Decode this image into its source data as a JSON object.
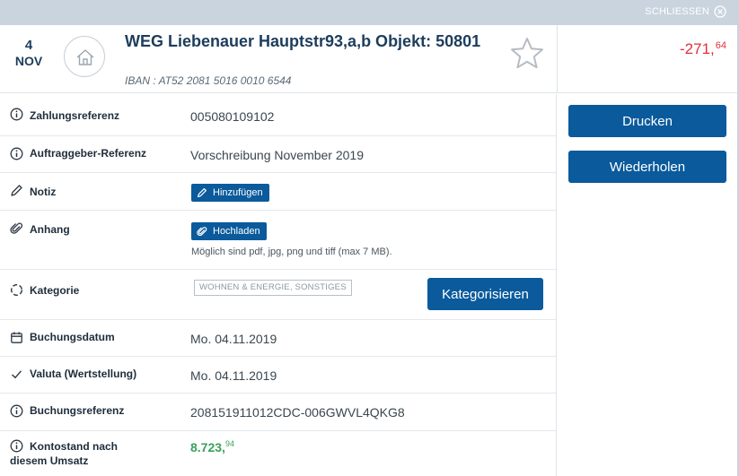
{
  "window": {
    "close_label": "SCHLIESSEN"
  },
  "header": {
    "date_day": "4",
    "date_month": "NOV",
    "title": "WEG Liebenauer Hauptstr93,a,b Objekt: 50801",
    "iban": "IBAN : AT52 2081 5016 0010 6544",
    "amount_main": "-271,",
    "amount_cents": "64",
    "amount_color": "#e0303a"
  },
  "details": {
    "zahlungsreferenz": {
      "label": "Zahlungsreferenz",
      "value": "005080109102"
    },
    "auftraggeber": {
      "label": "Auftraggeber-Referenz",
      "value": "Vorschreibung November 2019"
    },
    "notiz": {
      "label": "Notiz",
      "button": "Hinzufügen"
    },
    "anhang": {
      "label": "Anhang",
      "button": "Hochladen",
      "hint": "Möglich sind pdf, jpg, png und tiff (max 7 MB)."
    },
    "kategorie": {
      "label": "Kategorie",
      "tag": "WOHNEN & ENERGIE, SONSTIGES",
      "button": "Kategorisieren"
    },
    "buchungsdatum": {
      "label": "Buchungsdatum",
      "value": "Mo. 04.11.2019"
    },
    "valuta": {
      "label": "Valuta (Wertstellung)",
      "value": "Mo. 04.11.2019"
    },
    "buchungsreferenz": {
      "label": "Buchungsreferenz",
      "value": "208151911012CDC-006GWVL4QKG8"
    },
    "kontostand": {
      "label_line1": "Kontostand nach",
      "label_line2": "diesem Umsatz",
      "value_main": "8.723,",
      "value_cents": "94",
      "value_color": "#3aa358"
    }
  },
  "actions": {
    "print": "Drucken",
    "repeat": "Wiederholen"
  },
  "colors": {
    "primary": "#0a5a9c",
    "negative": "#e0303a",
    "positive": "#3aa358"
  }
}
